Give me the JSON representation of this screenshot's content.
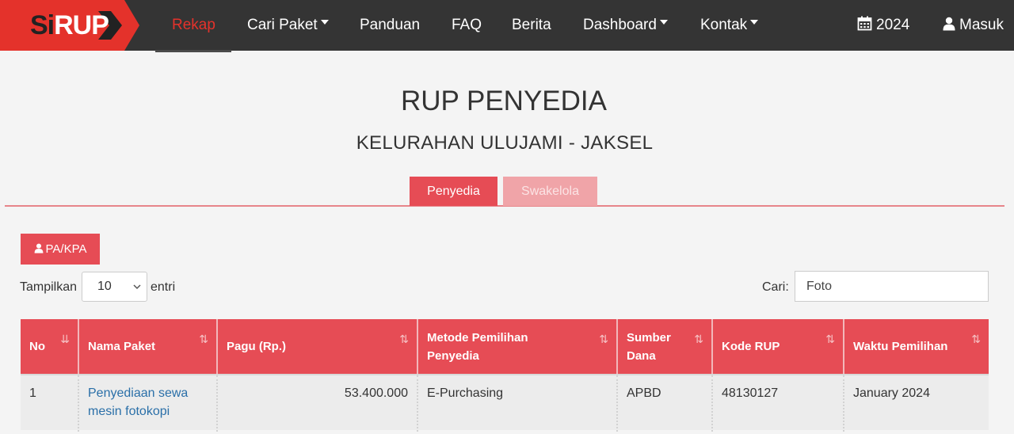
{
  "navbar": {
    "logo_part1": "Si",
    "logo_part2": "RUP",
    "items": [
      {
        "label": "Rekap",
        "active": true,
        "dropdown": false
      },
      {
        "label": "Cari Paket",
        "active": false,
        "dropdown": true
      },
      {
        "label": "Panduan",
        "active": false,
        "dropdown": false
      },
      {
        "label": "FAQ",
        "active": false,
        "dropdown": false
      },
      {
        "label": "Berita",
        "active": false,
        "dropdown": false
      },
      {
        "label": "Dashboard",
        "active": false,
        "dropdown": true
      },
      {
        "label": "Kontak",
        "active": false,
        "dropdown": true
      }
    ],
    "year": "2024",
    "login": "Masuk",
    "icons": {
      "year": "calendar-icon",
      "login": "user-icon"
    }
  },
  "page": {
    "title": "RUP PENYEDIA",
    "subtitle": "KELURAHAN ULUJAMI - JAKSEL"
  },
  "tabs": [
    {
      "label": "Penyedia",
      "active": true
    },
    {
      "label": "Swakelola",
      "active": false
    }
  ],
  "pa_button": "PA/KPA",
  "table_controls": {
    "length_label_before": "Tampilkan",
    "length_value": "10",
    "length_label_after": "entri",
    "search_label": "Cari:",
    "search_value": "Foto"
  },
  "table": {
    "columns": [
      "No",
      "Nama Paket",
      "Pagu (Rp.)",
      "Metode Pemilihan Penyedia",
      "Sumber Dana",
      "Kode RUP",
      "Waktu Pemilihan"
    ],
    "rows": [
      {
        "no": "1",
        "nama_paket": "Penyediaan sewa mesin fotokopi",
        "pagu": "53.400.000",
        "metode": "E-Purchasing",
        "sumber_dana": "APBD",
        "kode_rup": "48130127",
        "waktu": "January 2024"
      }
    ]
  },
  "colors": {
    "navbar_bg": "#343434",
    "accent_red": "#e64c55",
    "active_nav": "#e4322b",
    "link_blue": "#2a6fa8",
    "page_bg": "#f4f4f4"
  }
}
